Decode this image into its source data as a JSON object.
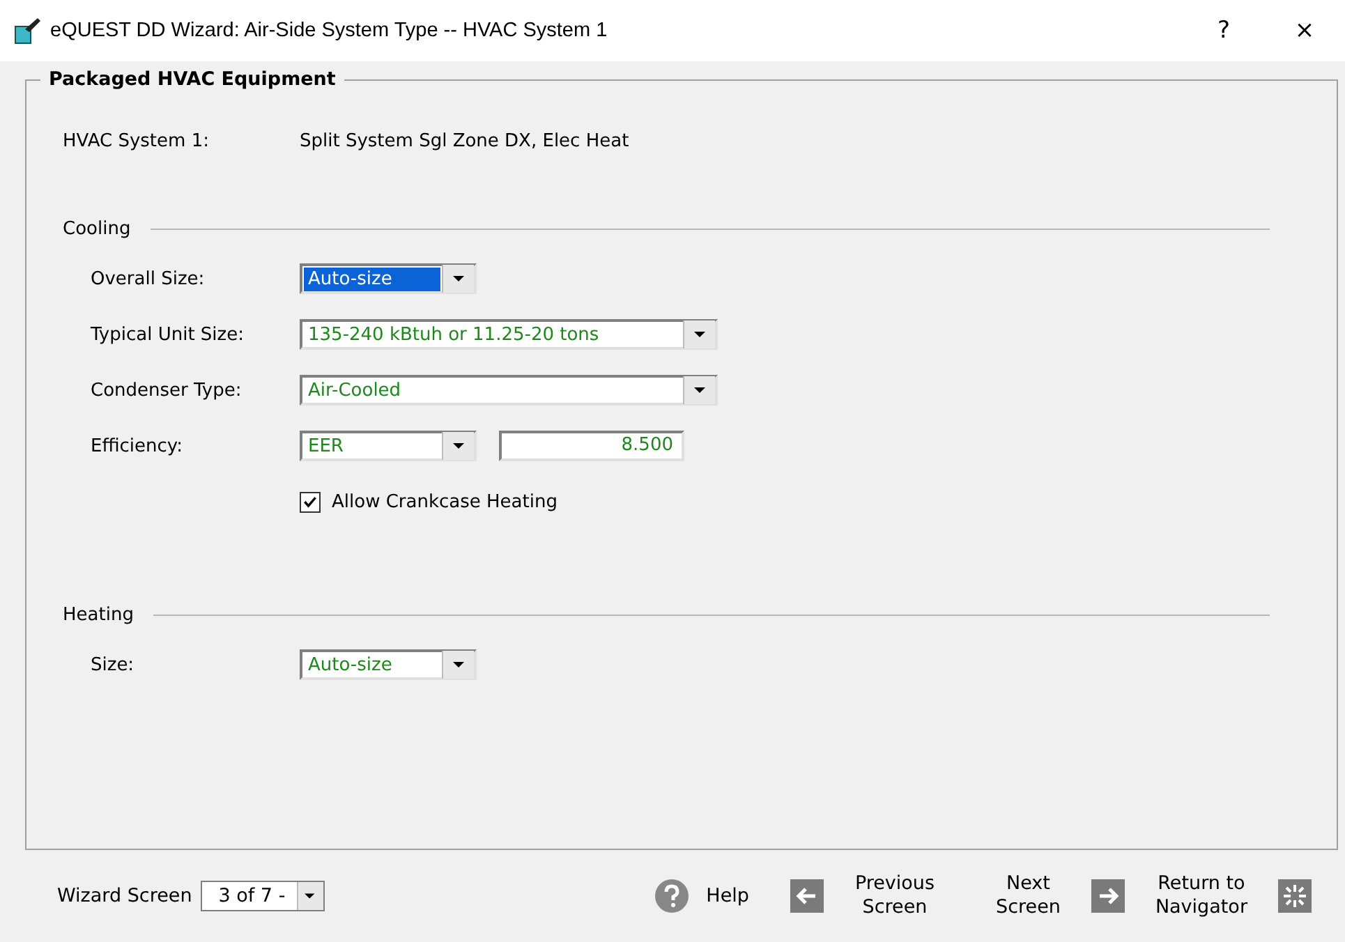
{
  "window": {
    "title": "eQUEST DD Wizard:  Air-Side System Type  --  HVAC System 1",
    "buttons": [
      "?",
      "×"
    ]
  },
  "group": {
    "title": "Packaged HVAC Equipment",
    "system_label": "HVAC System 1:",
    "system_value": "Split System Sgl Zone DX, Elec Heat"
  },
  "sections": [
    {
      "title": "Cooling",
      "rows": [
        {
          "kind": "dropdown",
          "label": "Overall Size:",
          "value": "Auto-size",
          "highlighted": true
        },
        {
          "kind": "dropdown_wide",
          "label": "Typical Unit Size:",
          "value": "135-240 kBtuh or 11.25-20 tons",
          "highlighted": false
        },
        {
          "kind": "dropdown_wide",
          "label": "Condenser Type:",
          "value": "Air-Cooled",
          "highlighted": false
        },
        {
          "kind": "dropdown_number",
          "label": "Efficiency:",
          "value": "EER",
          "number": "8.500",
          "highlighted": false
        },
        {
          "kind": "checkbox",
          "label": "Allow Crankcase Heating",
          "checked": true
        }
      ]
    },
    {
      "title": "Heating",
      "rows": [
        {
          "kind": "dropdown",
          "label": "Size:",
          "value": "Auto-size",
          "highlighted": false
        }
      ]
    }
  ],
  "footer": {
    "screen_label": "Wizard Screen",
    "screen_value": "3 of 7  -",
    "help": "Help",
    "previous": [
      "Previous",
      "Screen"
    ],
    "next": [
      "Next",
      "Screen"
    ],
    "return": [
      "Return to",
      "Navigator"
    ]
  }
}
